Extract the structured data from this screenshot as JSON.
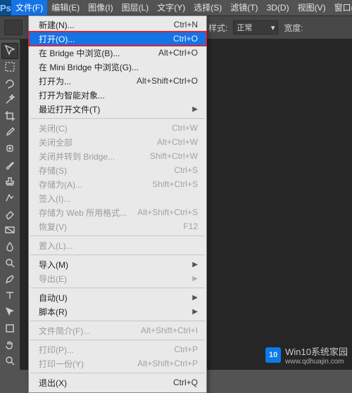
{
  "app": {
    "logo": "Ps"
  },
  "menubar": {
    "items": [
      {
        "label": "文件(F)",
        "active": true
      },
      {
        "label": "编辑(E)"
      },
      {
        "label": "图像(I)"
      },
      {
        "label": "图层(L)"
      },
      {
        "label": "文字(Y)"
      },
      {
        "label": "选择(S)"
      },
      {
        "label": "滤镜(T)"
      },
      {
        "label": "3D(D)"
      },
      {
        "label": "视图(V)"
      },
      {
        "label": "窗口(V)"
      }
    ]
  },
  "optionsbar": {
    "styles_label": "样式:",
    "styles_value": "正常",
    "width_label": "宽度:"
  },
  "tools": [
    "move",
    "marquee",
    "lasso",
    "wand",
    "crop",
    "eyedropper",
    "heal",
    "brush",
    "stamp",
    "history",
    "eraser",
    "gradient",
    "blur",
    "dodge",
    "pen",
    "type",
    "path",
    "rect",
    "hand",
    "zoom"
  ],
  "file_menu": {
    "groups": [
      [
        {
          "label": "新建(N)...",
          "shortcut": "Ctrl+N"
        },
        {
          "label": "打开(O)...",
          "shortcut": "Ctrl+O",
          "hover": true,
          "outlined": true
        },
        {
          "label": "在 Bridge 中浏览(B)...",
          "shortcut": "Alt+Ctrl+O"
        },
        {
          "label": "在 Mini Bridge 中浏览(G)..."
        },
        {
          "label": "打开为...",
          "shortcut": "Alt+Shift+Ctrl+O"
        },
        {
          "label": "打开为智能对象..."
        },
        {
          "label": "最近打开文件(T)",
          "submenu": true
        }
      ],
      [
        {
          "label": "关闭(C)",
          "shortcut": "Ctrl+W",
          "disabled": true
        },
        {
          "label": "关闭全部",
          "shortcut": "Alt+Ctrl+W",
          "disabled": true
        },
        {
          "label": "关闭并转到 Bridge...",
          "shortcut": "Shift+Ctrl+W",
          "disabled": true
        },
        {
          "label": "存储(S)",
          "shortcut": "Ctrl+S",
          "disabled": true
        },
        {
          "label": "存储为(A)...",
          "shortcut": "Shift+Ctrl+S",
          "disabled": true
        },
        {
          "label": "签入(I)...",
          "disabled": true
        },
        {
          "label": "存储为 Web 所用格式...",
          "shortcut": "Alt+Shift+Ctrl+S",
          "disabled": true
        },
        {
          "label": "恢复(V)",
          "shortcut": "F12",
          "disabled": true
        }
      ],
      [
        {
          "label": "置入(L)...",
          "disabled": true
        }
      ],
      [
        {
          "label": "导入(M)",
          "submenu": true
        },
        {
          "label": "导出(E)",
          "submenu": true,
          "disabled": true
        }
      ],
      [
        {
          "label": "自动(U)",
          "submenu": true
        },
        {
          "label": "脚本(R)",
          "submenu": true
        }
      ],
      [
        {
          "label": "文件简介(F)...",
          "shortcut": "Alt+Shift+Ctrl+I",
          "disabled": true
        }
      ],
      [
        {
          "label": "打印(P)...",
          "shortcut": "Ctrl+P",
          "disabled": true
        },
        {
          "label": "打印一份(Y)",
          "shortcut": "Alt+Shift+Ctrl+P",
          "disabled": true
        }
      ],
      [
        {
          "label": "退出(X)",
          "shortcut": "Ctrl+Q"
        }
      ]
    ]
  },
  "watermark": {
    "badge": "10",
    "line1": "Win10系统家园",
    "line2": "www.qdhuajin.com"
  }
}
